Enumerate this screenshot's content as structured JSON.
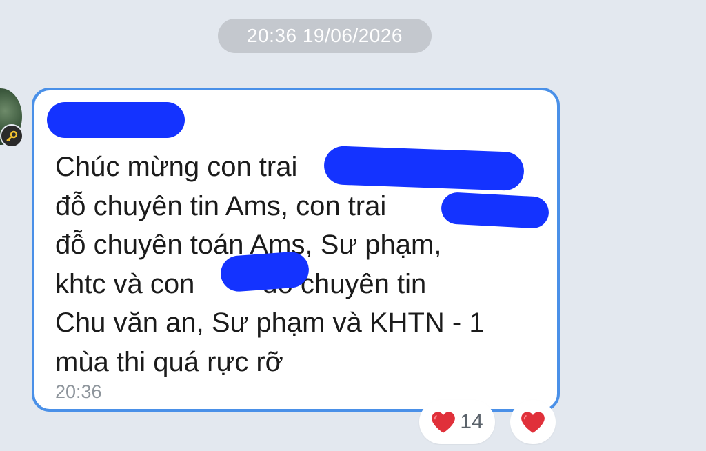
{
  "chat": {
    "date_separator": "20:36 19/06/2026",
    "message": {
      "text_lines": [
        "Chúc mừng con trai",
        "đỗ chuyên tin Ams, con trai",
        "đỗ chuyên toán Ams, Sư phạm,",
        "khtc và con",
        "Chu văn an, Sư phạm và KHTN - 1",
        "mùa thi quá rực rỡ"
      ],
      "line4_tail": "đỗ chuyên tin",
      "time": "20:36"
    },
    "reactions": {
      "heart_count": "14"
    },
    "colors": {
      "background": "#e3e8ef",
      "bubble_border": "#4a90e8",
      "redaction": "#1433ff",
      "heart": "#e0303a"
    }
  }
}
